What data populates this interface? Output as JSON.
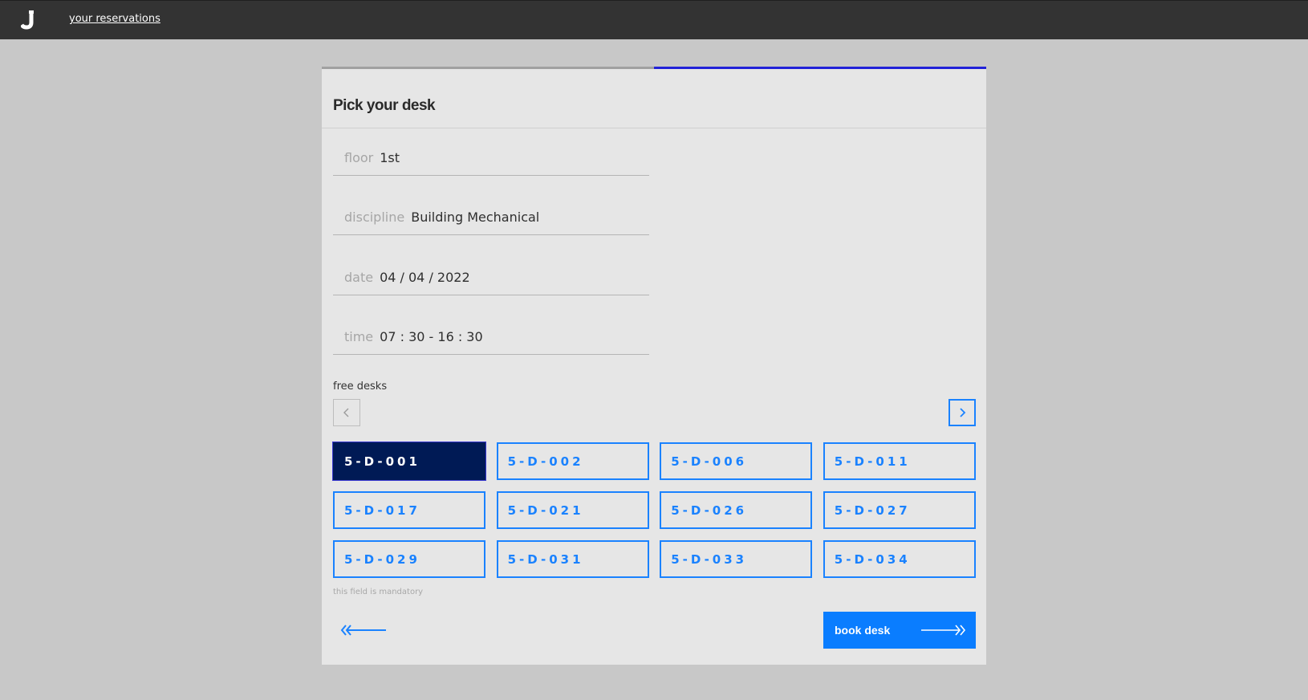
{
  "topbar": {
    "logo_icon": "j-logo-icon",
    "nav_link": "your reservations"
  },
  "wizard": {
    "progress_percent": 50,
    "title": "Pick your desk",
    "fields": [
      {
        "label": "floor",
        "value": "1st"
      },
      {
        "label": "discipline",
        "value": "Building Mechanical"
      },
      {
        "label": "date",
        "value": "04 / 04 / 2022"
      },
      {
        "label": "time",
        "value": "07 : 30 - 16 : 30"
      }
    ],
    "free_desks_label": "free desks",
    "prev_icon": "chevron-left-icon",
    "next_icon": "chevron-right-icon",
    "desks": [
      {
        "id": "5-D-001",
        "selected": true
      },
      {
        "id": "5-D-002",
        "selected": false
      },
      {
        "id": "5-D-006",
        "selected": false
      },
      {
        "id": "5-D-011",
        "selected": false
      },
      {
        "id": "5-D-017",
        "selected": false
      },
      {
        "id": "5-D-021",
        "selected": false
      },
      {
        "id": "5-D-026",
        "selected": false
      },
      {
        "id": "5-D-027",
        "selected": false
      },
      {
        "id": "5-D-029",
        "selected": false
      },
      {
        "id": "5-D-031",
        "selected": false
      },
      {
        "id": "5-D-033",
        "selected": false
      },
      {
        "id": "5-D-034",
        "selected": false
      }
    ],
    "mandatory_note": "this field is mandatory",
    "back_icon": "double-arrow-left-icon",
    "book_button": "book desk",
    "book_icon": "double-arrow-right-icon"
  },
  "colors": {
    "accent": "#1a82ff",
    "selected": "#001a55",
    "progress": "#2222d8",
    "topbar": "#333333"
  }
}
